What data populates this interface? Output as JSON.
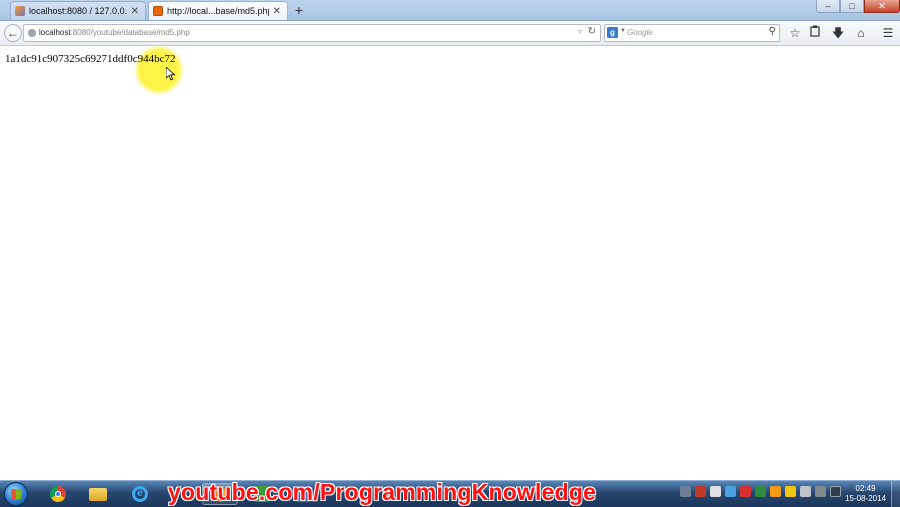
{
  "browser": {
    "tabs": [
      {
        "label": "localhost:8080 / 127.0.0.1 / ...",
        "active": false
      },
      {
        "label": "http://local...base/md5.php",
        "active": true
      }
    ],
    "new_tab_label": "+",
    "window_controls": {
      "minimize": "–",
      "maximize": "□",
      "close": "✕"
    },
    "url": {
      "host": "localhost",
      "rest": ":8080/youtube/database/md5.php"
    },
    "search": {
      "placeholder": "Google",
      "engine_letter": "g"
    }
  },
  "page": {
    "hash_text": "1a1dc91c907325c69271ddf0c944bc72"
  },
  "taskbar": {
    "watermark": "youtube.com/ProgrammingKnowledge",
    "clock": {
      "time": "02:49",
      "date": "15-08-2014"
    }
  },
  "colors": {
    "highlight": "#fff03c",
    "watermark": "#ff1111",
    "taskbar": "#27466f"
  }
}
